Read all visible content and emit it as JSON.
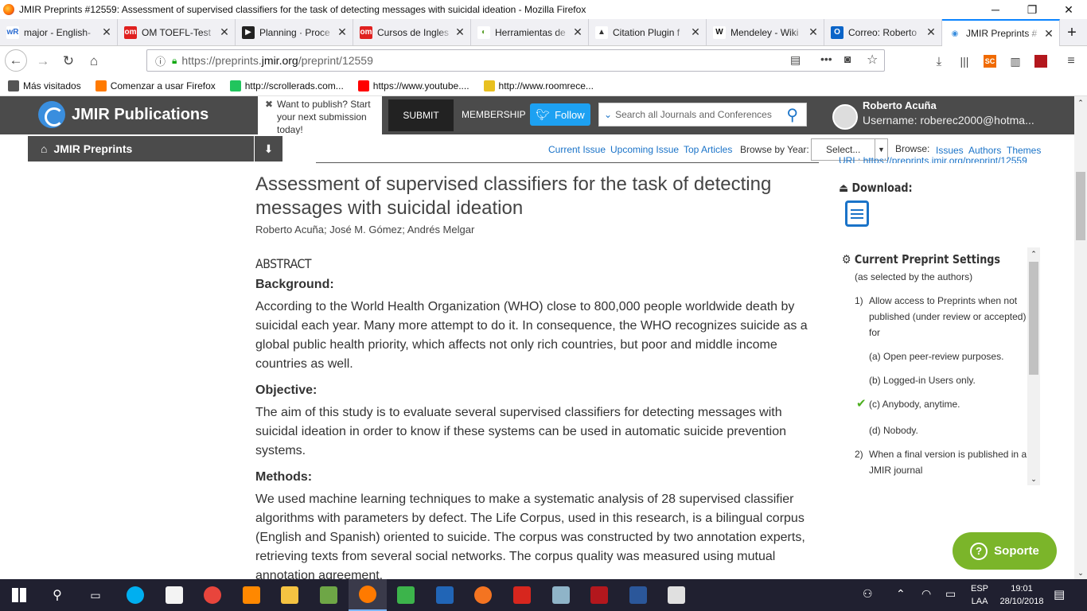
{
  "window": {
    "title": "JMIR Preprints #12559: Assessment of supervised classifiers for the task of detecting messages with suicidal ideation - Mozilla Firefox",
    "minimize": "─",
    "restore": "❐",
    "close": "✕"
  },
  "tabs": [
    {
      "label": "major - English-",
      "icon_text": "wR",
      "icon_color": "#ffffff",
      "icon_fg": "#2a6bd1"
    },
    {
      "label": "OM TOEFL-Test",
      "icon_text": "om",
      "icon_color": "#e0201f",
      "icon_fg": "#ffffff"
    },
    {
      "label": "Planning · Proce",
      "icon_text": "▶",
      "icon_color": "#222222",
      "icon_fg": "#ffffff"
    },
    {
      "label": "Cursos de Ingles",
      "icon_text": "om",
      "icon_color": "#e0201f",
      "icon_fg": "#ffffff"
    },
    {
      "label": "Herramientas de",
      "icon_text": "◐",
      "icon_color": "#ffffff",
      "icon_fg": "#5aa02c"
    },
    {
      "label": "Citation Plugin f",
      "icon_text": "▲",
      "icon_color": "#ffffff",
      "icon_fg": "#333333"
    },
    {
      "label": "Mendeley - Wiki",
      "icon_text": "W",
      "icon_color": "#ffffff",
      "icon_fg": "#111111"
    },
    {
      "label": "Correo: Roberto",
      "icon_text": "O",
      "icon_color": "#0a64c8",
      "icon_fg": "#ffffff"
    },
    {
      "label": "JMIR Preprints #",
      "icon_text": "◉",
      "icon_color": "#ffffff",
      "icon_fg": "#3a8ede"
    }
  ],
  "new_tab": "+",
  "url": {
    "prefix": "https://preprints.",
    "domain": "jmir.org",
    "path": "/preprint/12559"
  },
  "bookmarks": [
    {
      "label": "Más visitados",
      "color": "#555555"
    },
    {
      "label": "Comenzar a usar Firefox",
      "color": "#ff7a00"
    },
    {
      "label": "http://scrollerads.com...",
      "color": "#21c55d"
    },
    {
      "label": "https://www.youtube....",
      "color": "#ff0000"
    },
    {
      "label": "http://www.roomrece...",
      "color": "#e8c020"
    }
  ],
  "header": {
    "brand": "JMIR Publications",
    "want_to_publish": "Want to publish? Start your next submission today!",
    "submit": "SUBMIT",
    "membership": "MEMBERSHIP",
    "follow": "Follow",
    "search_placeholder": "Search all Journals and Conferences",
    "user_name": "Roberto Acuña",
    "username": "Username: roberec2000@hotma..."
  },
  "subnav": {
    "preprints": "JMIR Preprints",
    "current_issue": "Current Issue",
    "upcoming_issue": "Upcoming Issue",
    "top_articles": "Top Articles",
    "browse_by_year": "Browse by Year:",
    "select": "Select...",
    "browse": "Browse:",
    "issues": "Issues",
    "authors": "Authors",
    "themes": "Themes"
  },
  "article": {
    "title": "Assessment of supervised classifiers for the task of detecting messages with suicidal ideation",
    "authors": "Roberto Acuña;  José M. Gómez;  Andrés Melgar",
    "abstract_heading": "ABSTRACT",
    "sections": [
      {
        "heading": "Background:",
        "text": "According to the World Health Organization (WHO) close to 800,000 people worldwide death by suicidal each year. Many more attempt to do it. In consequence, the WHO recognizes suicide as a global public health priority, which affects not only rich countries, but poor and middle income countries as well."
      },
      {
        "heading": "Objective:",
        "text": "The aim of this study is to evaluate several supervised classifiers for detecting messages with suicidal ideation in order to know if these systems can be used in automatic suicide prevention systems."
      },
      {
        "heading": "Methods:",
        "text": "We used machine learning techniques to make a systematic analysis of 28 supervised classifier algorithms with parameters by defect. The Life Corpus, used in this research, is a bilingual corpus (English and Spanish) oriented to suicide. The corpus was constructed by two annotation experts, retrieving texts from several social networks. The corpus quality was measured using mutual annotation agreement."
      }
    ]
  },
  "sidebar": {
    "url_partial": "URL: https://preprints.jmir.org/preprint/12559",
    "download": "Download:",
    "settings_title": "Current Preprint Settings",
    "settings_sub": "(as selected by the authors)",
    "item1_num": "1)",
    "item1": "Allow access to Preprints when not published (under review or accepted) for",
    "opt_a": "(a) Open peer-review purposes.",
    "opt_b": "(b) Logged-in Users only.",
    "opt_c": "(c) Anybody, anytime.",
    "opt_d": "(d) Nobody.",
    "item2_num": "2)",
    "item2": "When a final version is published in a JMIR journal"
  },
  "soporte": "Soporte",
  "taskbar": {
    "lang1": "ESP",
    "lang2": "LAA",
    "time": "19:01",
    "date": "28/10/2018"
  }
}
